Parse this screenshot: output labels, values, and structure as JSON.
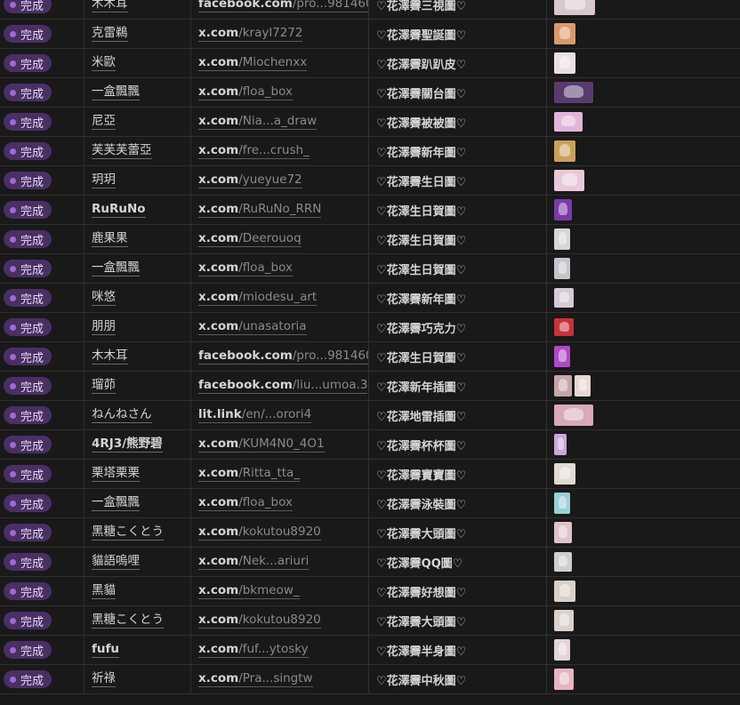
{
  "rows": [
    {
      "status": "完成",
      "name": "木木耳",
      "name_bold": false,
      "host": "facebook.com",
      "path": "/pro...981460",
      "title": "♡花澤霽三視圖♡",
      "thumbs": [
        {
          "w": 46,
          "h": 24,
          "color": "#d9c7cf"
        }
      ]
    },
    {
      "status": "完成",
      "name": "克雷鵜",
      "name_bold": false,
      "host": "x.com",
      "path": "/krayl7272",
      "title": "♡花澤霽聖誕圖♡",
      "thumbs": [
        {
          "w": 24,
          "h": 24,
          "color": "#d99a6a"
        }
      ]
    },
    {
      "status": "完成",
      "name": "米歐",
      "name_bold": false,
      "host": "x.com",
      "path": "/Miochenxx",
      "title": "♡花澤霽趴趴皮♡",
      "thumbs": [
        {
          "w": 24,
          "h": 24,
          "color": "#e9dfe4"
        }
      ]
    },
    {
      "status": "完成",
      "name": "一盒飄飄",
      "name_bold": false,
      "host": "x.com",
      "path": "/floa_box",
      "title": "♡花澤霽關台圖♡",
      "thumbs": [
        {
          "w": 44,
          "h": 24,
          "color": "#5a3b6e"
        }
      ]
    },
    {
      "status": "完成",
      "name": "尼亞",
      "name_bold": false,
      "host": "x.com",
      "path": "/Nia...a_draw",
      "title": "♡花澤霽被被圖♡",
      "thumbs": [
        {
          "w": 32,
          "h": 22,
          "color": "#e0b6d8"
        }
      ]
    },
    {
      "status": "完成",
      "name": "芙芙芙蕾亞",
      "name_bold": false,
      "host": "x.com",
      "path": "/fre...crush_",
      "title": "♡花澤霽新年圖♡",
      "thumbs": [
        {
          "w": 24,
          "h": 24,
          "color": "#c9a15a"
        }
      ]
    },
    {
      "status": "完成",
      "name": "玥玥",
      "name_bold": false,
      "host": "x.com",
      "path": "/yueyue72",
      "title": "♡花澤霽生日圖♡",
      "thumbs": [
        {
          "w": 34,
          "h": 24,
          "color": "#e9c8d9"
        }
      ]
    },
    {
      "status": "完成",
      "name": "RuRuNo",
      "name_bold": true,
      "host": "x.com",
      "path": "/RuRuNo_RRN",
      "title": "♡花澤生日賀圖♡",
      "thumbs": [
        {
          "w": 20,
          "h": 24,
          "color": "#7a3aa8"
        }
      ]
    },
    {
      "status": "完成",
      "name": "鹿果果",
      "name_bold": false,
      "host": "x.com",
      "path": "/Deerouoq",
      "title": "♡花澤生日賀圖♡",
      "thumbs": [
        {
          "w": 18,
          "h": 24,
          "color": "#d8d4da"
        }
      ]
    },
    {
      "status": "完成",
      "name": "一盒飄飄",
      "name_bold": false,
      "host": "x.com",
      "path": "/floa_box",
      "title": "♡花澤生日賀圖♡",
      "thumbs": [
        {
          "w": 18,
          "h": 24,
          "color": "#c8c3cc"
        }
      ]
    },
    {
      "status": "完成",
      "name": "咪悠",
      "name_bold": false,
      "host": "x.com",
      "path": "/miodesu_art",
      "title": "♡花澤霽新年圖♡",
      "thumbs": [
        {
          "w": 22,
          "h": 22,
          "color": "#d6cad6"
        }
      ]
    },
    {
      "status": "完成",
      "name": "朋朋",
      "name_bold": false,
      "host": "x.com",
      "path": "/unasatoria",
      "title": "♡花澤霽巧克力♡",
      "thumbs": [
        {
          "w": 22,
          "h": 20,
          "color": "#c8323c"
        }
      ]
    },
    {
      "status": "完成",
      "name": "木木耳",
      "name_bold": false,
      "host": "facebook.com",
      "path": "/pro...981460",
      "title": "♡花澤生日賀圖♡",
      "thumbs": [
        {
          "w": 18,
          "h": 24,
          "color": "#b048c8"
        }
      ]
    },
    {
      "status": "完成",
      "name": "瑠茆",
      "name_bold": false,
      "host": "facebook.com",
      "path": "/liu...umoa.3",
      "title": "♡花澤新年插圖♡",
      "thumbs": [
        {
          "w": 20,
          "h": 24,
          "color": "#c6a5a8"
        },
        {
          "w": 18,
          "h": 24,
          "color": "#e6d8d2"
        }
      ]
    },
    {
      "status": "完成",
      "name": "ねんねさん",
      "name_bold": false,
      "host": "lit.link",
      "path": "/en/...orori4",
      "title": "♡花澤地雷插圖♡",
      "thumbs": [
        {
          "w": 44,
          "h": 24,
          "color": "#d8a9b8"
        }
      ]
    },
    {
      "status": "完成",
      "name": "4RJ3/熊野碧",
      "name_bold": true,
      "host": "x.com",
      "path": "/KUM4N0_4O1",
      "title": "♡花澤霽杯杯圖♡",
      "thumbs": [
        {
          "w": 14,
          "h": 24,
          "color": "#c8a8d8"
        }
      ]
    },
    {
      "status": "完成",
      "name": "栗塔栗栗",
      "name_bold": false,
      "host": "x.com",
      "path": "/Ritta_tta_",
      "title": "♡花澤霽寶寶圖♡",
      "thumbs": [
        {
          "w": 24,
          "h": 24,
          "color": "#e2d9d2"
        }
      ]
    },
    {
      "status": "完成",
      "name": "一盒飄飄",
      "name_bold": false,
      "host": "x.com",
      "path": "/floa_box",
      "title": "♡花澤霽泳裝圖♡",
      "thumbs": [
        {
          "w": 18,
          "h": 24,
          "color": "#9ad0d8"
        }
      ]
    },
    {
      "status": "完成",
      "name": "黑糖こくとう",
      "name_bold": false,
      "host": "x.com",
      "path": "/kokutou8920",
      "title": "♡花澤霽大頭圖♡",
      "thumbs": [
        {
          "w": 20,
          "h": 24,
          "color": "#e0c2cc"
        }
      ]
    },
    {
      "status": "完成",
      "name": "貓語嗚哩",
      "name_bold": false,
      "host": "x.com",
      "path": "/Nek...ariuri",
      "title": "♡花澤霽QQ圖♡",
      "thumbs": [
        {
          "w": 20,
          "h": 22,
          "color": "#cfcfcf"
        }
      ]
    },
    {
      "status": "完成",
      "name": "黑貓",
      "name_bold": false,
      "host": "x.com",
      "path": "/bkmeow_",
      "title": "♡花澤霽好想圖♡",
      "thumbs": [
        {
          "w": 24,
          "h": 24,
          "color": "#d9d0c8"
        }
      ]
    },
    {
      "status": "完成",
      "name": "黑糖こくとう",
      "name_bold": false,
      "host": "x.com",
      "path": "/kokutou8920",
      "title": "♡花澤霽大頭圖♡",
      "thumbs": [
        {
          "w": 22,
          "h": 24,
          "color": "#dcd2cc"
        }
      ]
    },
    {
      "status": "完成",
      "name": "fufu",
      "name_bold": true,
      "host": "x.com",
      "path": "/fuf...ytosky",
      "title": "♡花澤霽半身圖♡",
      "thumbs": [
        {
          "w": 18,
          "h": 24,
          "color": "#e2d4d8"
        }
      ]
    },
    {
      "status": "完成",
      "name": "祈祿",
      "name_bold": false,
      "host": "x.com",
      "path": "/Pra...singtw",
      "title": "♡花澤霽中秋圖♡",
      "thumbs": [
        {
          "w": 22,
          "h": 24,
          "color": "#e8b4c2"
        }
      ]
    }
  ]
}
